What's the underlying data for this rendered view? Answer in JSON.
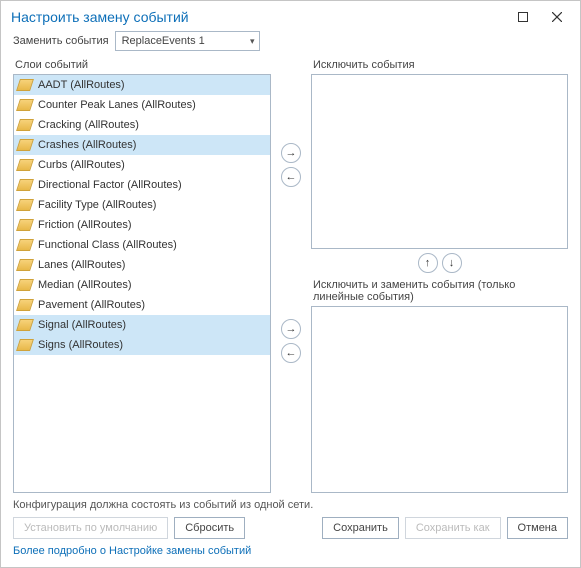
{
  "titlebar": {
    "title": "Настроить замену событий"
  },
  "dropdown": {
    "label": "Заменить события",
    "value": "ReplaceEvents 1"
  },
  "labels": {
    "event_layers": "Слои событий",
    "exclude_events": "Исключить события",
    "exclude_replace": "Исключить и заменить события (только линейные события)",
    "config_note": "Конфигурация должна состоять из событий из одной сети."
  },
  "event_layers": [
    {
      "label": "AADT (AllRoutes)",
      "selected": true
    },
    {
      "label": "Counter Peak Lanes (AllRoutes)",
      "selected": false
    },
    {
      "label": "Cracking (AllRoutes)",
      "selected": false
    },
    {
      "label": "Crashes (AllRoutes)",
      "selected": true
    },
    {
      "label": "Curbs (AllRoutes)",
      "selected": false
    },
    {
      "label": "Directional Factor (AllRoutes)",
      "selected": false
    },
    {
      "label": "Facility Type (AllRoutes)",
      "selected": false
    },
    {
      "label": "Friction (AllRoutes)",
      "selected": false
    },
    {
      "label": "Functional Class (AllRoutes)",
      "selected": false
    },
    {
      "label": "Lanes (AllRoutes)",
      "selected": false
    },
    {
      "label": "Median (AllRoutes)",
      "selected": false
    },
    {
      "label": "Pavement (AllRoutes)",
      "selected": false
    },
    {
      "label": "Signal (AllRoutes)",
      "selected": true
    },
    {
      "label": "Signs (AllRoutes)",
      "selected": true
    }
  ],
  "buttons": {
    "set_default": "Установить по умолчанию",
    "reset": "Сбросить",
    "save": "Сохранить",
    "save_as": "Сохранить как",
    "cancel": "Отмена"
  },
  "link": {
    "text": "Более подробно о Настройке замены событий"
  }
}
